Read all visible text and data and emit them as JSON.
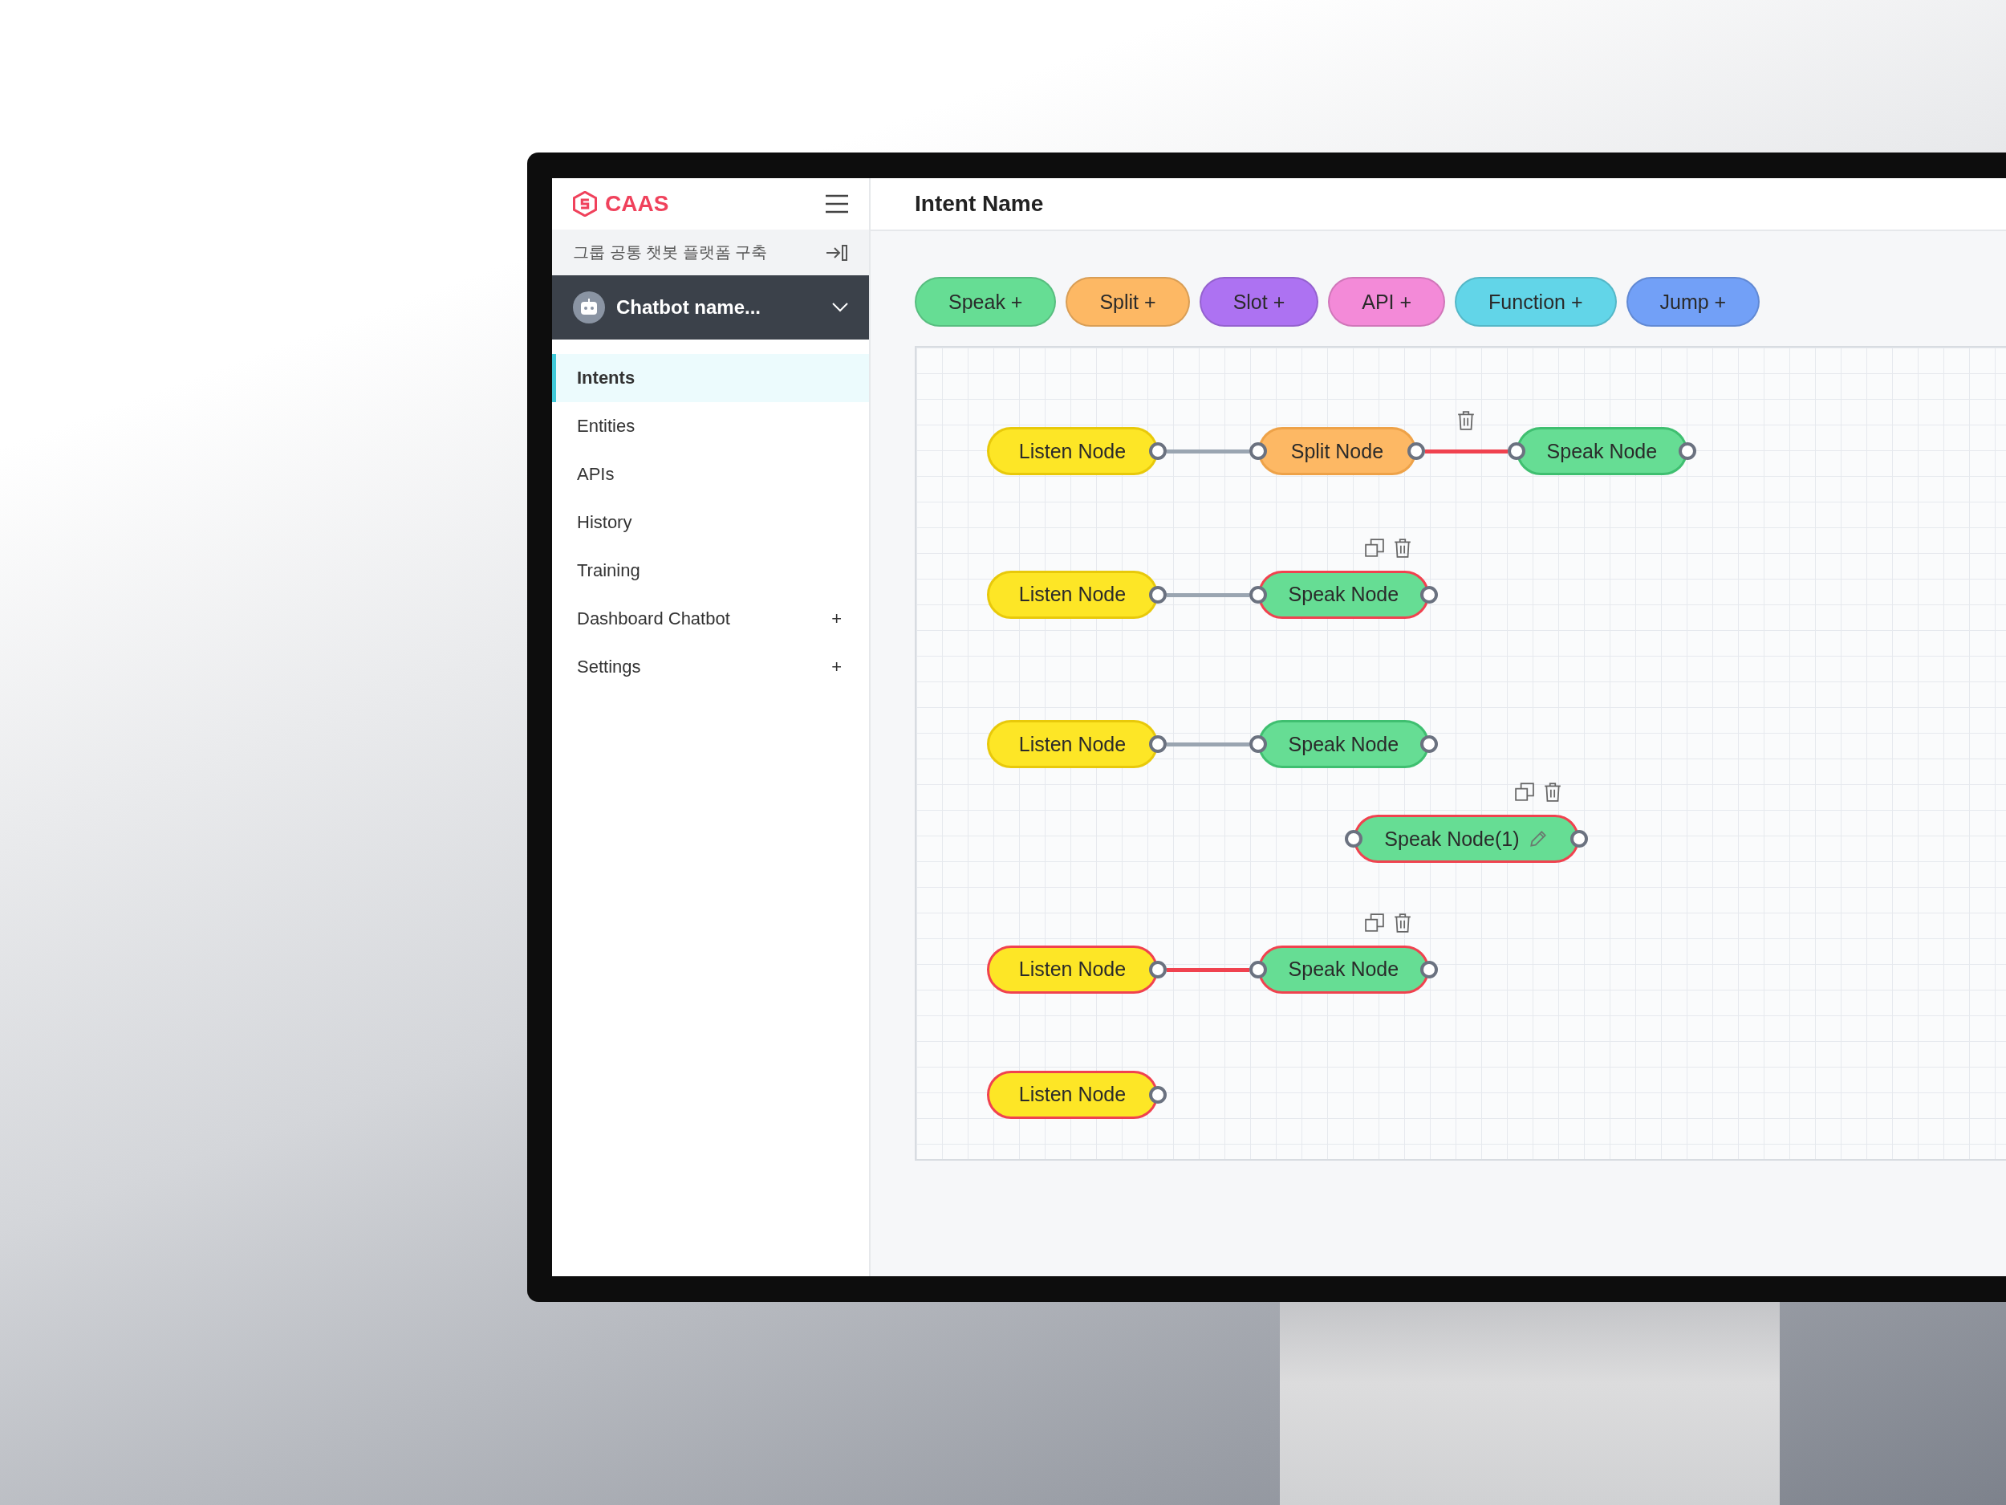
{
  "sidebar": {
    "logo": "CAAS",
    "project": "그룹 공통 챗봇 플랫폼 구축",
    "chatbot": "Chatbot name...",
    "menu": [
      {
        "label": "Intents",
        "selected": true
      },
      {
        "label": "Entities",
        "selected": false
      },
      {
        "label": "APIs",
        "selected": false
      },
      {
        "label": "History",
        "selected": false
      },
      {
        "label": "Training",
        "selected": false
      },
      {
        "label": "Dashboard Chatbot",
        "selected": false,
        "toggle": "+"
      },
      {
        "label": "Settings",
        "selected": false,
        "toggle": "+"
      }
    ]
  },
  "header": {
    "title": "Intent Name"
  },
  "toolbar": [
    {
      "label": "Speak +",
      "color": "#66dd94"
    },
    {
      "label": "Split +",
      "color": "#fdb864"
    },
    {
      "label": "Slot +",
      "color": "#ad72f2"
    },
    {
      "label": "API +",
      "color": "#f38ad8"
    },
    {
      "label": "Function +",
      "color": "#62d5e8"
    },
    {
      "label": "Jump +",
      "color": "#72a0f7"
    }
  ],
  "canvas": {
    "nodes": [
      {
        "label": "Listen Node",
        "kind": "listen",
        "selected": false,
        "toolbar": false,
        "editing": false
      },
      {
        "label": "Split Node",
        "kind": "split",
        "selected": false,
        "toolbar": false,
        "editing": false
      },
      {
        "label": "Speak Node",
        "kind": "speak",
        "selected": false,
        "toolbar": false,
        "editing": false
      },
      {
        "label": "Listen Node",
        "kind": "listen",
        "selected": false,
        "toolbar": false,
        "editing": false
      },
      {
        "label": "Speak Node",
        "kind": "speak",
        "selected": true,
        "toolbar": true,
        "editing": false
      },
      {
        "label": "Listen Node",
        "kind": "listen",
        "selected": false,
        "toolbar": false,
        "editing": false
      },
      {
        "label": "Speak Node",
        "kind": "speak",
        "selected": false,
        "toolbar": false,
        "editing": false
      },
      {
        "label": "Speak Node(1)",
        "kind": "speak",
        "selected": true,
        "toolbar": true,
        "editing": true
      },
      {
        "label": "Listen Node",
        "kind": "listen",
        "selected": true,
        "toolbar": false,
        "editing": false
      },
      {
        "label": "Speak Node",
        "kind": "speak",
        "selected": true,
        "toolbar": true,
        "editing": false
      },
      {
        "label": "Listen Node",
        "kind": "listen",
        "selected": true,
        "toolbar": false,
        "editing": false
      }
    ],
    "edges": [
      {
        "selected": false,
        "show_delete": false
      },
      {
        "selected": true,
        "show_delete": true
      },
      {
        "selected": false,
        "show_delete": false
      },
      {
        "selected": false,
        "show_delete": false
      },
      {
        "selected": true,
        "show_delete": false
      }
    ]
  }
}
